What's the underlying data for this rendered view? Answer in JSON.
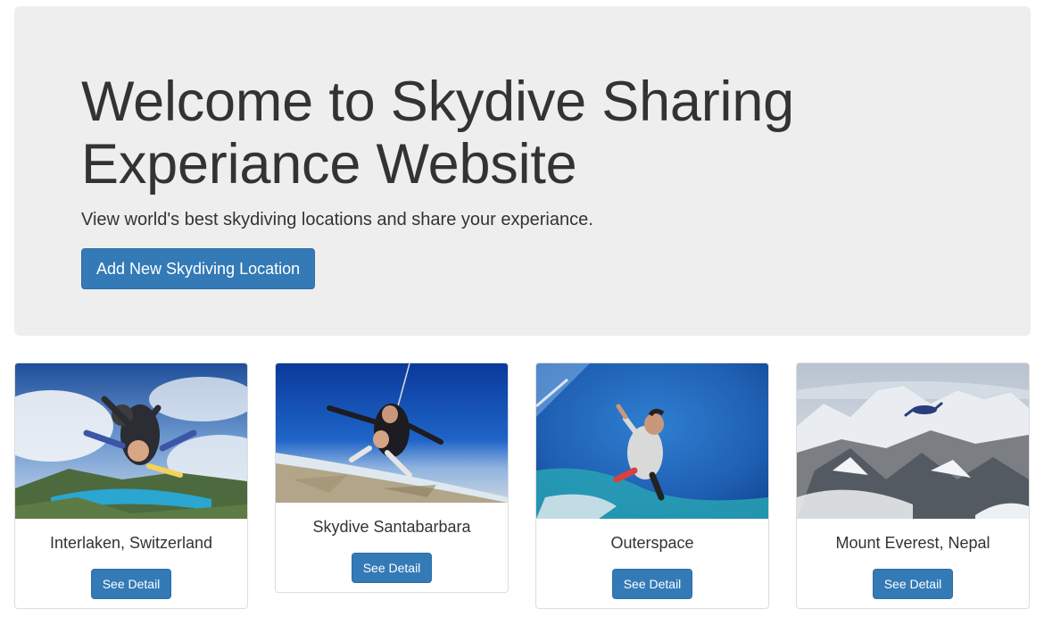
{
  "jumbotron": {
    "title": "Welcome to Skydive Sharing Experiance Website",
    "subtitle": "View world's best skydiving locations and share your experiance.",
    "add_button_label": "Add New Skydiving Location"
  },
  "locations": [
    {
      "name": "Interlaken, Switzerland",
      "button_label": "See Detail"
    },
    {
      "name": "Skydive Santabarbara",
      "button_label": "See Detail"
    },
    {
      "name": "Outerspace",
      "button_label": "See Detail"
    },
    {
      "name": "Mount Everest, Nepal",
      "button_label": "See Detail"
    }
  ],
  "colors": {
    "primary": "#337ab7",
    "jumbotron_bg": "#eeeeee"
  }
}
